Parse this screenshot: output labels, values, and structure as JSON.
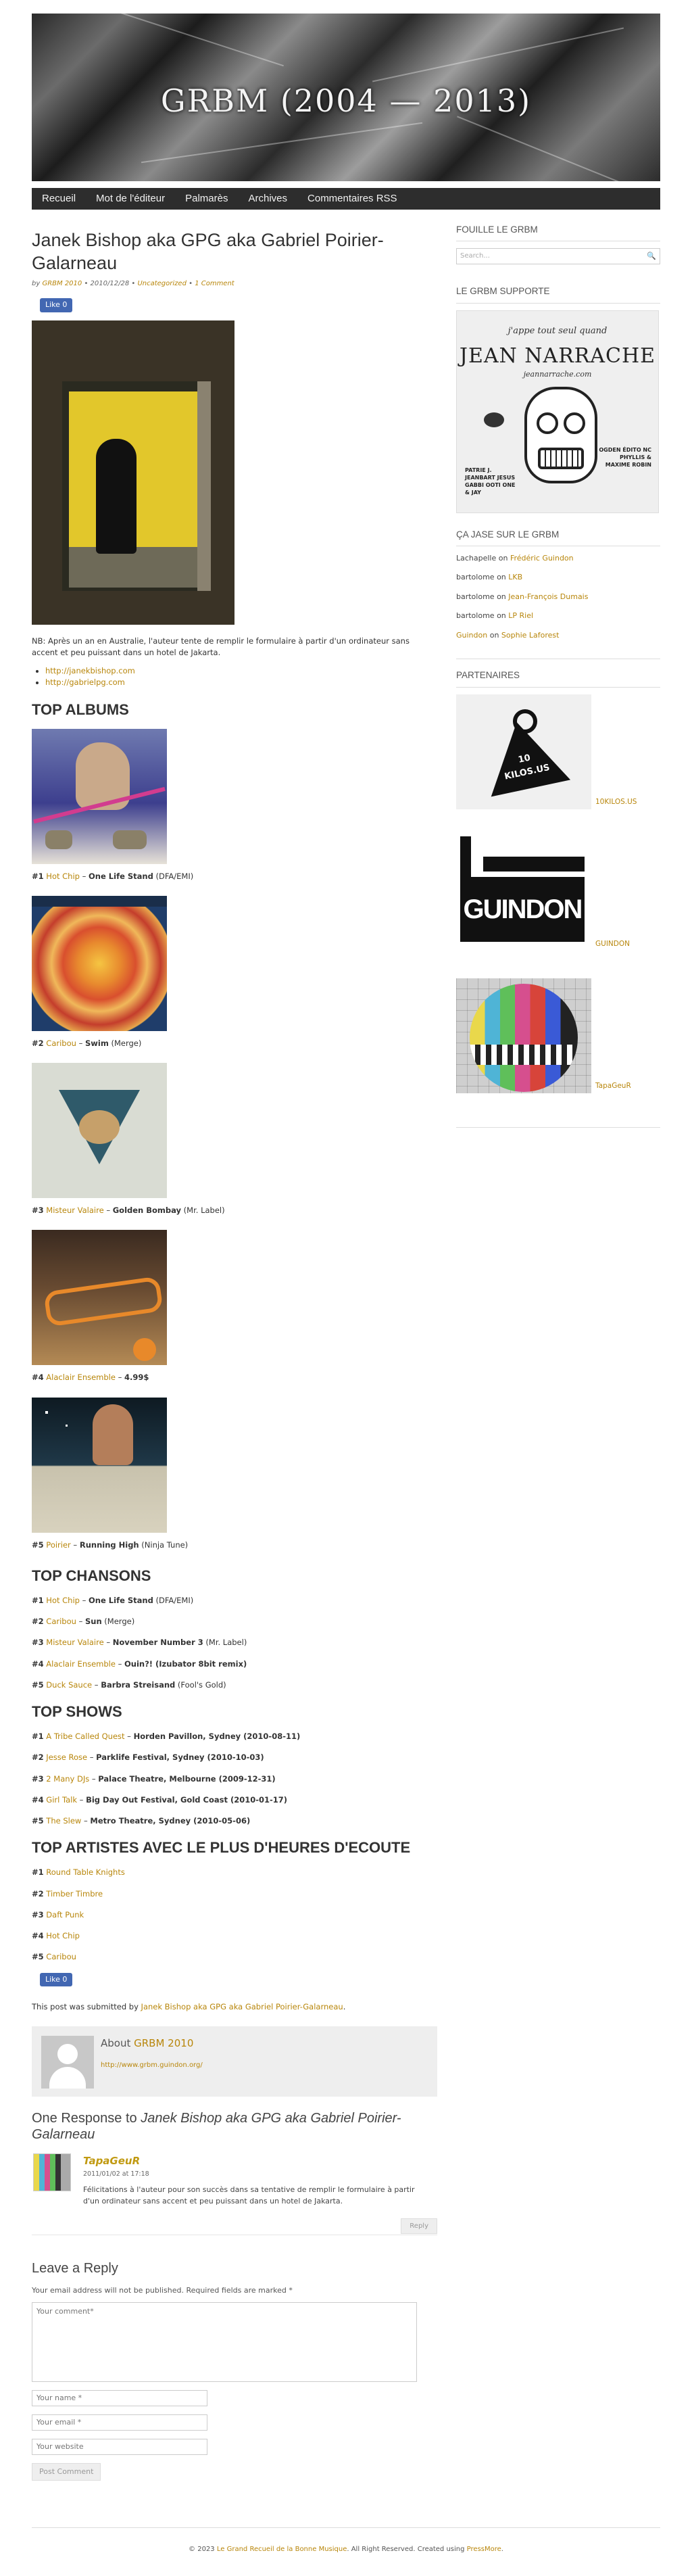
{
  "header": {
    "site_title": "GRBM (2004 — 2013)",
    "nav": [
      "Recueil",
      "Mot de l'éditeur",
      "Palmarès",
      "Archives",
      "Commentaires RSS"
    ]
  },
  "post": {
    "title": "Janek Bishop aka GPG aka Gabriel Poirier-Galarneau",
    "meta_prefix": "by",
    "meta_author": "GRBM 2010",
    "meta_date": "• 2010/12/28 •",
    "meta_category": "Uncategorized",
    "meta_comments": "1 Comment",
    "like_label": "Like 0",
    "note": "NB: Après un an en Australie, l'auteur tente de remplir le formulaire à partir d'un ordinateur sans accent et peu puissant dans un hotel de Jakarta.",
    "links": [
      "http://janekbishop.com",
      "http://gabrielpg.com"
    ]
  },
  "top_albums": {
    "heading": "TOP ALBUMS",
    "items": [
      {
        "rank": "#1",
        "artist": "Hot Chip",
        "sep": " – ",
        "title": "One Life Stand",
        "label": " (DFA/EMI)"
      },
      {
        "rank": "#2",
        "artist": "Caribou",
        "sep": " – ",
        "title": "Swim",
        "label": " (Merge)"
      },
      {
        "rank": "#3",
        "artist": "Misteur Valaire",
        "sep": " – ",
        "title": "Golden Bombay",
        "label": " (Mr. Label)"
      },
      {
        "rank": "#4",
        "artist": "Alaclair Ensemble",
        "sep": " – ",
        "title": "4.99$",
        "label": ""
      },
      {
        "rank": "#5",
        "artist": "Poirier",
        "sep": " – ",
        "title": "Running High",
        "label": " (Ninja Tune)"
      }
    ]
  },
  "top_chansons": {
    "heading": "TOP CHANSONS",
    "items": [
      {
        "rank": "#1",
        "artist": "Hot Chip",
        "sep": " – ",
        "title": "One Life Stand",
        "label": " (DFA/EMI)"
      },
      {
        "rank": "#2",
        "artist": "Caribou",
        "sep": " – ",
        "title": "Sun",
        "label": " (Merge)"
      },
      {
        "rank": "#3",
        "artist": "Misteur Valaire",
        "sep": " – ",
        "title": "November Number 3",
        "label": " (Mr. Label)"
      },
      {
        "rank": "#4",
        "artist": "Alaclair Ensemble",
        "sep": " – ",
        "title": "Ouin?! (Izubator 8bit remix)",
        "label": ""
      },
      {
        "rank": "#5",
        "artist": "Duck Sauce",
        "sep": " – ",
        "title": "Barbra Streisand",
        "label": " (Fool's Gold)"
      }
    ]
  },
  "top_shows": {
    "heading": "TOP SHOWS",
    "items": [
      {
        "rank": "#1",
        "artist": "A Tribe Called Quest",
        "sep": " – ",
        "title": "Horden Pavillon, Sydney (2010-08-11)"
      },
      {
        "rank": "#2",
        "artist": "Jesse Rose",
        "sep": " – ",
        "title": "Parklife Festival, Sydney (2010-10-03)"
      },
      {
        "rank": "#3",
        "artist": "2 Many DJs",
        "sep": " – ",
        "title": "Palace Theatre, Melbourne (2009-12-31)"
      },
      {
        "rank": "#4",
        "artist": "Girl Talk",
        "sep": " – ",
        "title": "Big Day Out Festival, Gold Coast (2010-01-17)"
      },
      {
        "rank": "#5",
        "artist": "The Slew",
        "sep": " – ",
        "title": "Metro Theatre, Sydney (2010-05-06)"
      }
    ]
  },
  "top_artistes": {
    "heading": "TOP ARTISTES AVEC LE PLUS D'HEURES D'ECOUTE",
    "items": [
      {
        "rank": "#1",
        "artist": "Round Table Knights"
      },
      {
        "rank": "#2",
        "artist": "Timber Timbre"
      },
      {
        "rank": "#3",
        "artist": "Daft Punk"
      },
      {
        "rank": "#4",
        "artist": "Hot Chip"
      },
      {
        "rank": "#5",
        "artist": "Caribou"
      }
    ]
  },
  "submitted": {
    "prefix": "This post was submitted by",
    "author": "Janek Bishop aka GPG aka Gabriel Poirier-Galarneau",
    "suffix": "."
  },
  "author_box": {
    "about": "About",
    "name": "GRBM 2010",
    "url": "http://www.grbm.guindon.org/"
  },
  "responses": {
    "heading_prefix": "One Response to",
    "heading_title": "Janek Bishop aka GPG aka Gabriel Poirier-Galarneau",
    "comment": {
      "author": "TapaGeuR",
      "date": "2011/01/02 at 17:18",
      "text": "Félicitations à l'auteur pour son succès dans sa tentative de remplir le formulaire à partir d'un ordinateur sans accent et peu puissant dans un hotel de Jakarta.",
      "reply": "Reply"
    }
  },
  "reply_form": {
    "heading": "Leave a Reply",
    "notice": "Your email address will not be published. Required fields are marked *",
    "comment_placeholder": "Your comment*",
    "name_placeholder": "Your name *",
    "email_placeholder": "Your email *",
    "website_placeholder": "Your website",
    "submit": "Post Comment"
  },
  "sidebar": {
    "search_heading": "FOUILLE LE GRBM",
    "search_placeholder": "Search...",
    "support_heading": "LE GRBM SUPPORTE",
    "jean": {
      "tagline": "j'appe tout seul quand",
      "name": "JEAN NARRACHE",
      "site": "jeannarrache.com",
      "left_credits": "PATRIE J. JEANBART JESUS GABBI OOTI ONE & JAY",
      "right_credits": "OGDEN ÉDITO NC PHYLLIS & MAXIME ROBIN"
    },
    "comments_heading": "ÇA JASE SUR LE GRBM",
    "recent_comments": [
      {
        "who": "Lachapelle",
        "on": "on",
        "post": "Frédéric Guindon"
      },
      {
        "who": "bartolome",
        "on": "on",
        "post": "LKB"
      },
      {
        "who": "bartolome",
        "on": "on",
        "post": "Jean-François Dumais"
      },
      {
        "who": "bartolome",
        "on": "on",
        "post": "LP Riel"
      },
      {
        "who": "Guindon",
        "on": "on",
        "post": "Sophie Laforest"
      }
    ],
    "partners_heading": "PARTENAIRES",
    "partners": [
      {
        "label": "10KILOS.US",
        "logo_text": "10 KILOS.US"
      },
      {
        "label": "GUINDON",
        "logo_text": "GUINDON"
      },
      {
        "label": "TapaGeuR"
      }
    ]
  },
  "footer": {
    "prefix": "© 2023",
    "site": "Le Grand Recueil de la Bonne Musique",
    "middle": ". All Right Reserved. Created using",
    "theme": "PressMore",
    "suffix": "."
  }
}
